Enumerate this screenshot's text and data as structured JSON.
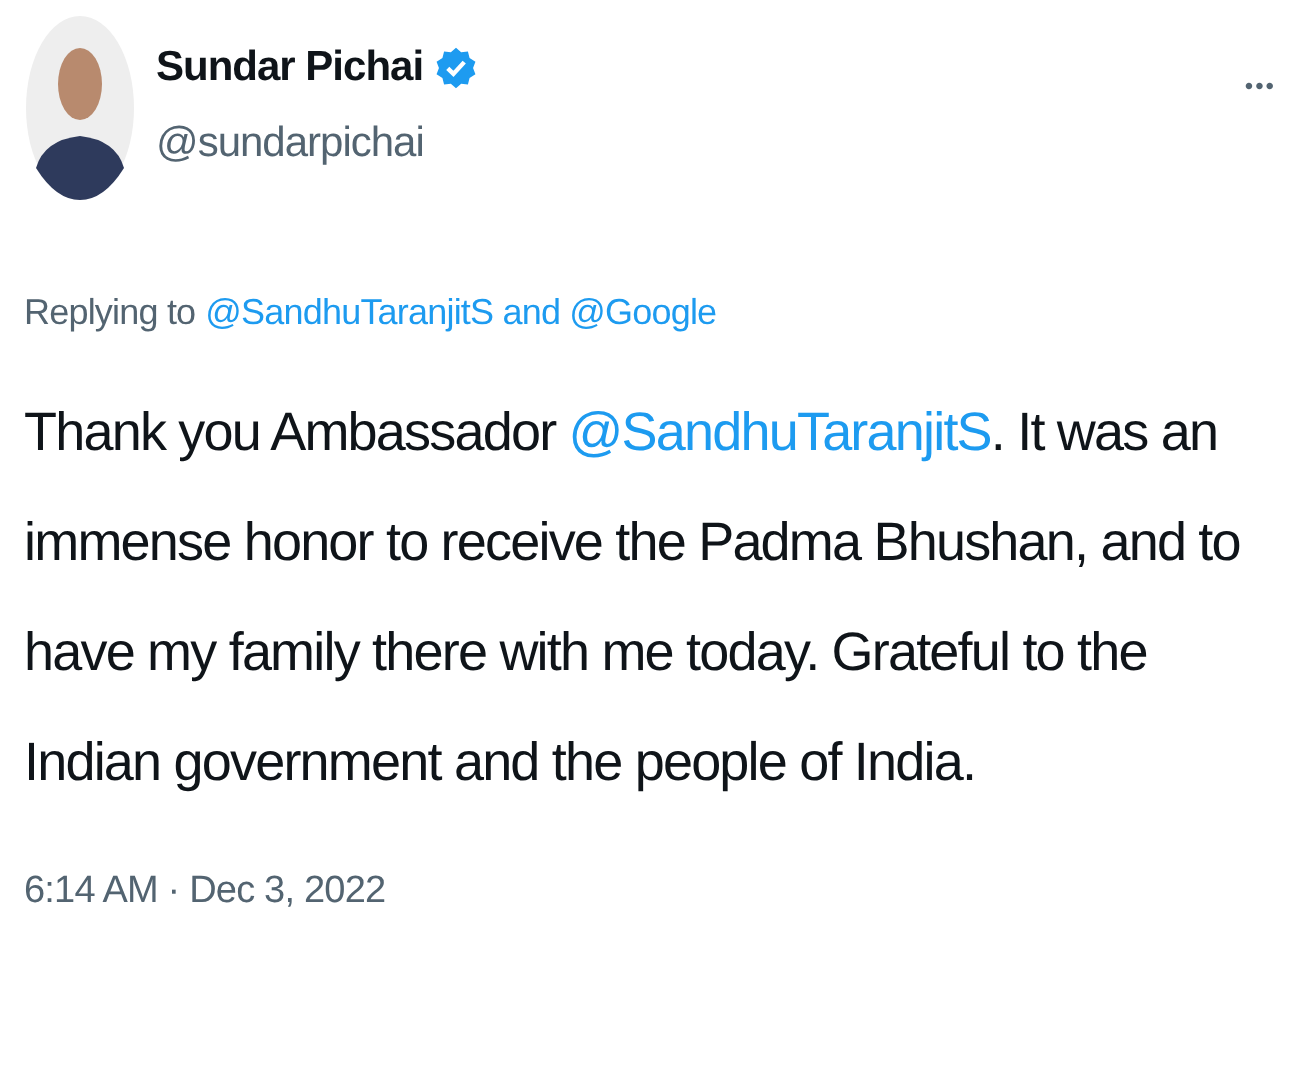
{
  "author": {
    "name": "Sundar Pichai",
    "verified": true,
    "handle": "@sundarpichai"
  },
  "menu": "•••",
  "replying": {
    "prefix": "Replying to",
    "targets": "@SandhuTaranjitS and @Google"
  },
  "body": [
    {
      "kind": "text",
      "text": "Thank you Ambassador "
    },
    {
      "kind": "mention",
      "text": "@SandhuTaranjitS"
    },
    {
      "kind": "text",
      "text": ". It was an immense honor to receive the Padma Bhushan, and to have my family there with me today. Grateful to the Indian government and the people of India."
    }
  ],
  "timestamp": "6:14 AM · Dec 3, 2022"
}
